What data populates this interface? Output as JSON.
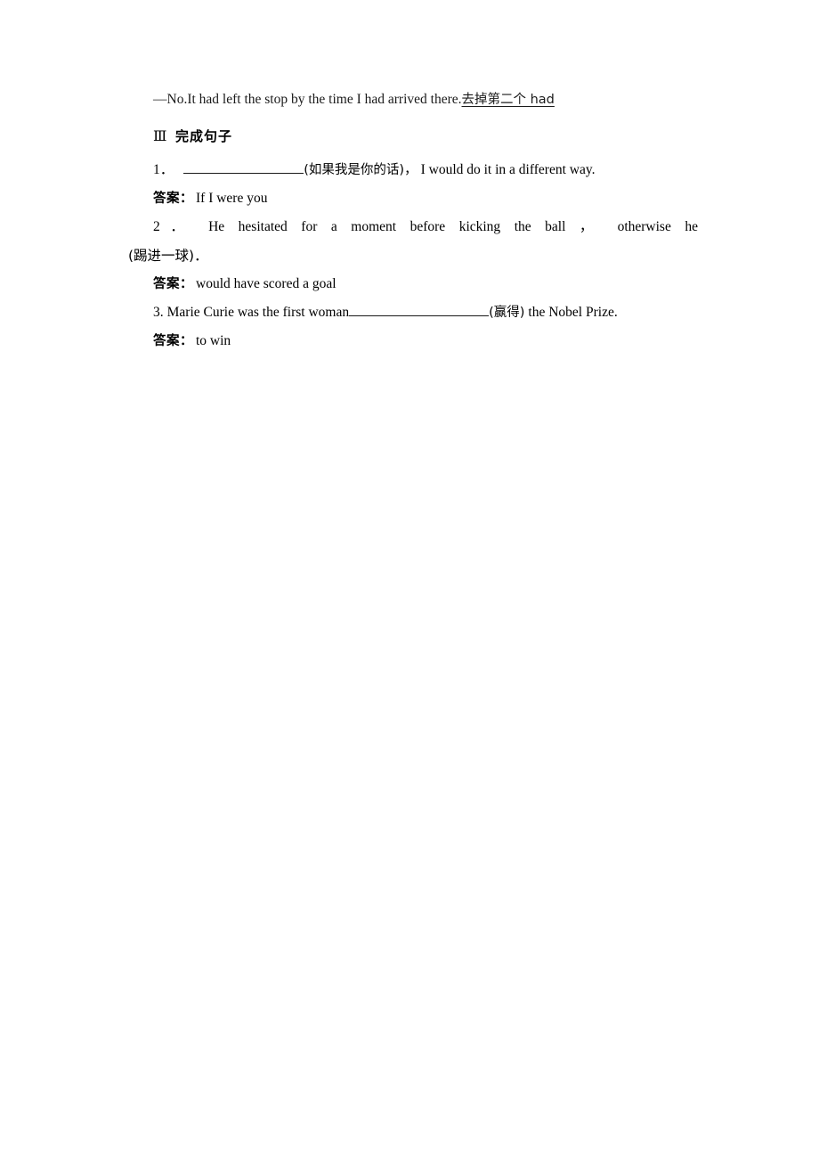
{
  "document": {
    "dialogue_answer": {
      "prefix": "—No.It had left the stop by the time I had arrived there.",
      "annotation": "去掉第二个 had"
    },
    "section": {
      "numeral": "Ⅲ",
      "title": "完成句子"
    },
    "questions": [
      {
        "number": "1．",
        "blank_hint": "(如果我是你的话)，",
        "tail": "I would do it in a different way.",
        "answer_label": "答案：",
        "answer_text": "If I were you"
      },
      {
        "number": "2．",
        "text": "He hesitated for a moment before kicking the ball ，  otherwise he",
        "continuation": "(踢进一球)．",
        "answer_label": "答案：",
        "answer_text": "would have scored a goal"
      },
      {
        "number": "3.",
        "lead": "Marie Curie was the first woman",
        "blank_hint": "(赢得)",
        "tail": "the Nobel Prize.",
        "answer_label": "答案：",
        "answer_text": "to win"
      }
    ]
  },
  "colors": {
    "page_background": "#ffffff",
    "text": "#1a1a1a",
    "rule": "#1a1a1a"
  }
}
